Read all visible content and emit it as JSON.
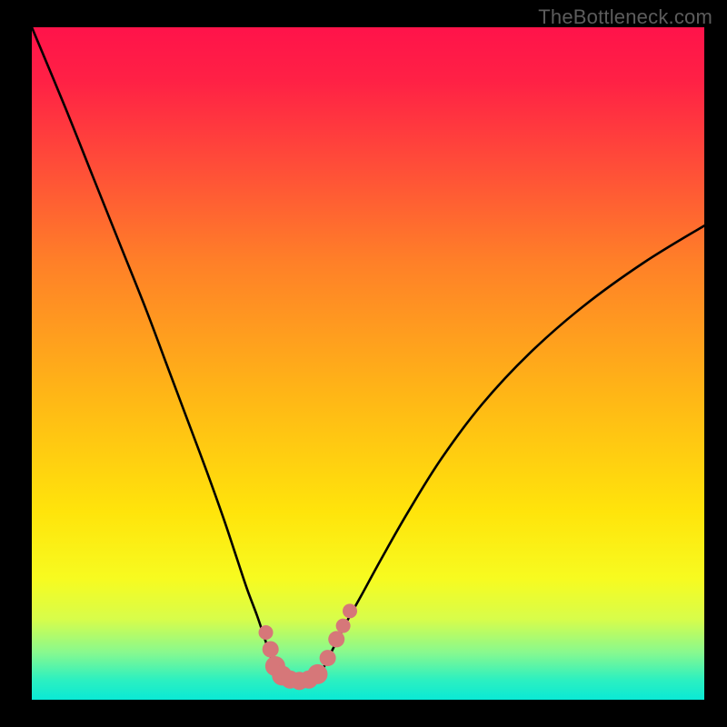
{
  "watermark": "TheBottleneck.com",
  "colors": {
    "black": "#000000",
    "curve": "#000000",
    "marker_fill": "#d67779",
    "marker_stroke": "#c45d60"
  },
  "chart_data": {
    "type": "line",
    "title": "",
    "xlabel": "",
    "ylabel": "",
    "xlim": [
      0,
      1
    ],
    "ylim": [
      0,
      1
    ],
    "gradient_stops": [
      {
        "offset": 0.0,
        "color": "#ff134a"
      },
      {
        "offset": 0.08,
        "color": "#ff2145"
      },
      {
        "offset": 0.2,
        "color": "#ff4b39"
      },
      {
        "offset": 0.35,
        "color": "#ff8028"
      },
      {
        "offset": 0.55,
        "color": "#ffb716"
      },
      {
        "offset": 0.72,
        "color": "#ffe40b"
      },
      {
        "offset": 0.82,
        "color": "#f7fb20"
      },
      {
        "offset": 0.88,
        "color": "#d8fd4a"
      },
      {
        "offset": 0.93,
        "color": "#87f98f"
      },
      {
        "offset": 0.97,
        "color": "#2df0c0"
      },
      {
        "offset": 1.0,
        "color": "#0ae9d5"
      }
    ],
    "series": [
      {
        "name": "bottleneck-left-curve",
        "x": [
          0.0,
          0.05,
          0.09,
          0.13,
          0.17,
          0.2,
          0.23,
          0.26,
          0.285,
          0.305,
          0.32,
          0.335,
          0.345,
          0.355,
          0.362
        ],
        "y": [
          1.0,
          0.88,
          0.78,
          0.68,
          0.58,
          0.5,
          0.42,
          0.34,
          0.27,
          0.21,
          0.165,
          0.125,
          0.095,
          0.065,
          0.04
        ]
      },
      {
        "name": "bottleneck-right-curve",
        "x": [
          0.43,
          0.445,
          0.465,
          0.49,
          0.52,
          0.56,
          0.61,
          0.67,
          0.74,
          0.82,
          0.91,
          1.0
        ],
        "y": [
          0.04,
          0.07,
          0.11,
          0.155,
          0.21,
          0.28,
          0.36,
          0.44,
          0.515,
          0.585,
          0.65,
          0.705
        ]
      },
      {
        "name": "bottleneck-floor",
        "x": [
          0.362,
          0.38,
          0.395,
          0.41,
          0.42,
          0.43
        ],
        "y": [
          0.04,
          0.03,
          0.028,
          0.028,
          0.03,
          0.04
        ]
      }
    ],
    "markers": {
      "name": "sample-points",
      "points": [
        {
          "x": 0.348,
          "y": 0.1,
          "r": 8
        },
        {
          "x": 0.355,
          "y": 0.075,
          "r": 9
        },
        {
          "x": 0.362,
          "y": 0.05,
          "r": 11
        },
        {
          "x": 0.372,
          "y": 0.036,
          "r": 11
        },
        {
          "x": 0.384,
          "y": 0.03,
          "r": 10
        },
        {
          "x": 0.398,
          "y": 0.028,
          "r": 10
        },
        {
          "x": 0.412,
          "y": 0.03,
          "r": 10
        },
        {
          "x": 0.425,
          "y": 0.038,
          "r": 11
        },
        {
          "x": 0.44,
          "y": 0.062,
          "r": 9
        },
        {
          "x": 0.453,
          "y": 0.09,
          "r": 9
        },
        {
          "x": 0.463,
          "y": 0.11,
          "r": 8
        },
        {
          "x": 0.473,
          "y": 0.132,
          "r": 8
        }
      ]
    }
  }
}
